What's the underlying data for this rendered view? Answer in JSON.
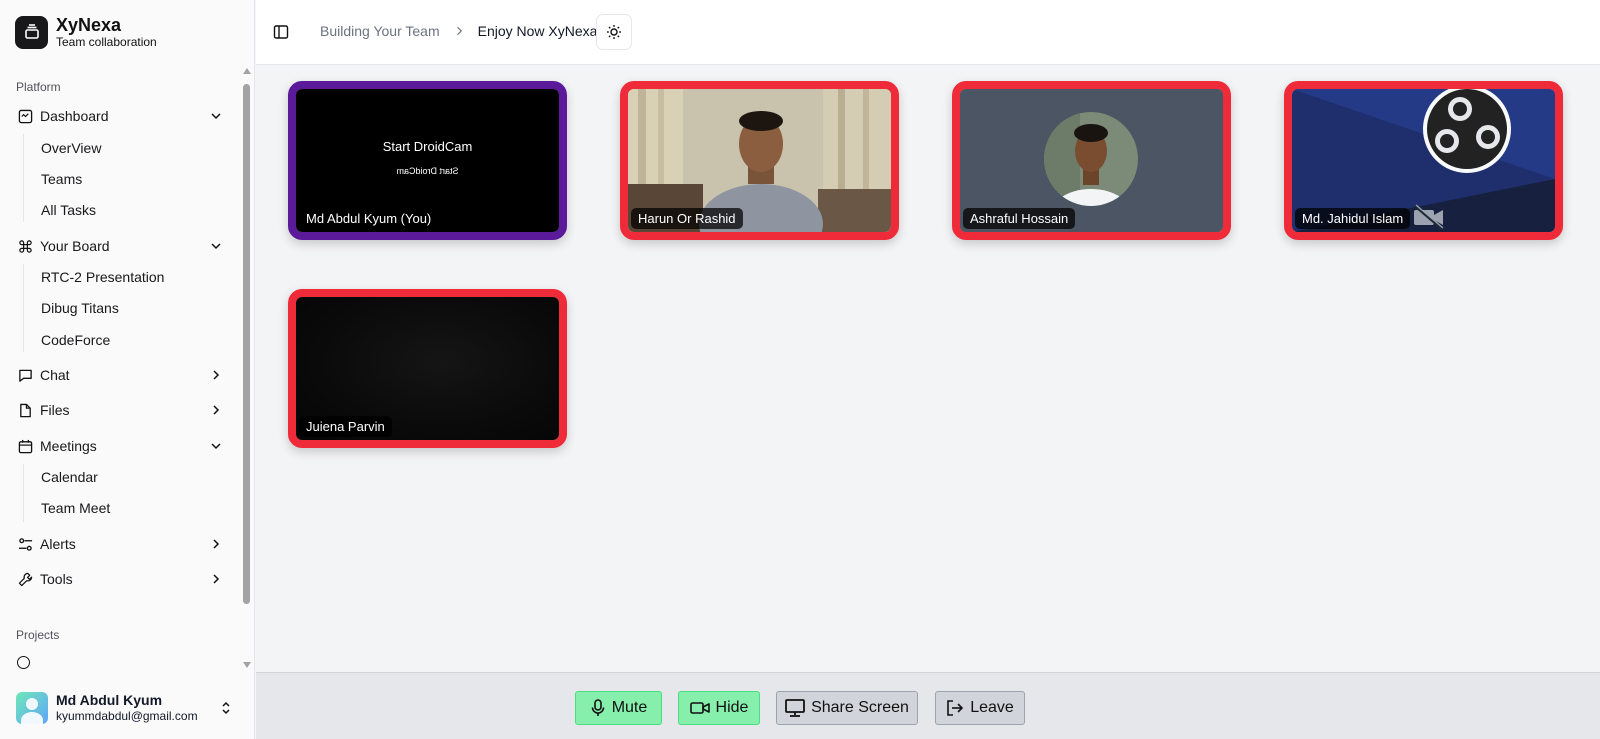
{
  "app": {
    "name": "XyNexa",
    "tagline": "Team collaboration"
  },
  "sidebar": {
    "platform_label": "Platform",
    "projects_label": "Projects",
    "items": [
      {
        "label": "Dashboard",
        "icon": "dashboard-icon",
        "expanded": true,
        "children": [
          "OverView",
          "Teams",
          "All Tasks"
        ]
      },
      {
        "label": "Your Board",
        "icon": "command-icon",
        "expanded": true,
        "children": [
          "RTC-2 Presentation",
          "Dibug Titans",
          "CodeForce"
        ]
      },
      {
        "label": "Chat",
        "icon": "message-icon",
        "expanded": false,
        "children": []
      },
      {
        "label": "Files",
        "icon": "file-icon",
        "expanded": false,
        "children": []
      },
      {
        "label": "Meetings",
        "icon": "calendar-icon",
        "expanded": true,
        "children": [
          "Calendar",
          "Team Meet"
        ]
      },
      {
        "label": "Alerts",
        "icon": "settings-sliders-icon",
        "expanded": false,
        "children": []
      },
      {
        "label": "Tools",
        "icon": "wrench-icon",
        "expanded": false,
        "children": []
      }
    ],
    "user": {
      "name": "Md Abdul Kyum",
      "email": "kyummdabdul@gmail.com"
    }
  },
  "header": {
    "breadcrumb": [
      "Building Your Team",
      "Enjoy Now XyNexa"
    ]
  },
  "participants": [
    {
      "name": "Md Abdul Kyum (You)",
      "is_self": true,
      "feed": "droidcam",
      "feed_text": "Start DroidCam",
      "feed_text_mirrored": "Start DroidCam"
    },
    {
      "name": "Harun Or Rashid",
      "is_self": false,
      "feed": "camera"
    },
    {
      "name": "Ashraful Hossain",
      "is_self": false,
      "feed": "avatar"
    },
    {
      "name": "Md. Jahidul Islam",
      "is_self": false,
      "feed": "obs",
      "camera_off": true
    },
    {
      "name": "Juiena Parvin",
      "is_self": false,
      "feed": "dark"
    }
  ],
  "controls": {
    "mute": "Mute",
    "hide": "Hide",
    "share": "Share Screen",
    "leave": "Leave"
  },
  "colors": {
    "self_border": "#5b1a9a",
    "peer_border": "#ef2b3a",
    "active_control": "#86efac",
    "neutral_control": "#d1d5db"
  }
}
